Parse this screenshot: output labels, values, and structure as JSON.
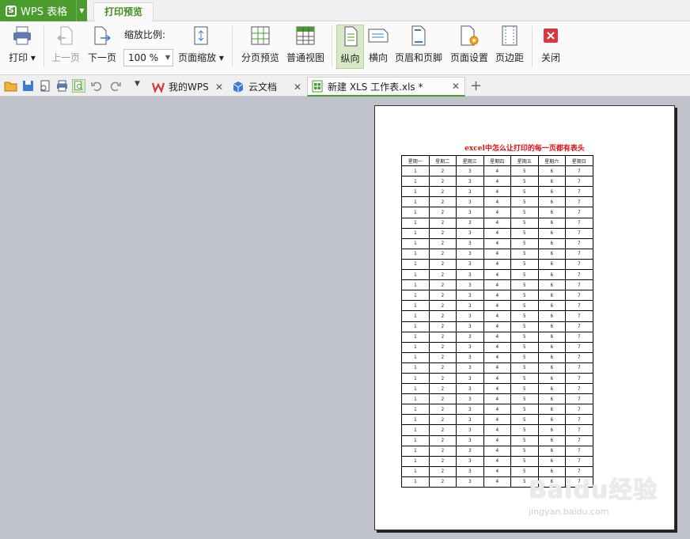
{
  "app": {
    "title": "WPS 表格",
    "active_tab": "打印预览"
  },
  "ribbon": {
    "print": "打印",
    "prev_page": "上一页",
    "next_page": "下一页",
    "zoom_label": "缩放比例:",
    "zoom_value": "100 %",
    "page_zoom": "页面缩放",
    "page_break_preview": "分页预览",
    "normal_view": "普通视图",
    "portrait": "纵向",
    "landscape": "横向",
    "header_footer": "页眉和页脚",
    "page_setup": "页面设置",
    "margins": "页边距",
    "close": "关闭"
  },
  "doc_tabs": [
    {
      "label": "我的WPS"
    },
    {
      "label": "云文档"
    },
    {
      "label": "新建 XLS 工作表.xls *"
    }
  ],
  "sheet": {
    "title": "excel中怎么让打印的每一页都有表头",
    "headers": [
      "星期一",
      "星期二",
      "星期三",
      "星期四",
      "星期五",
      "星期六",
      "星期日"
    ],
    "row_values": [
      "1",
      "2",
      "3",
      "4",
      "5",
      "6",
      "7"
    ],
    "row_count": 31
  },
  "watermark": {
    "brand": "Baidu经验",
    "url": "jingyan.baidu.com"
  },
  "colors": {
    "brand_green": "#4a9c2d",
    "title_red": "#e01010",
    "canvas": "#bfc2cb"
  }
}
